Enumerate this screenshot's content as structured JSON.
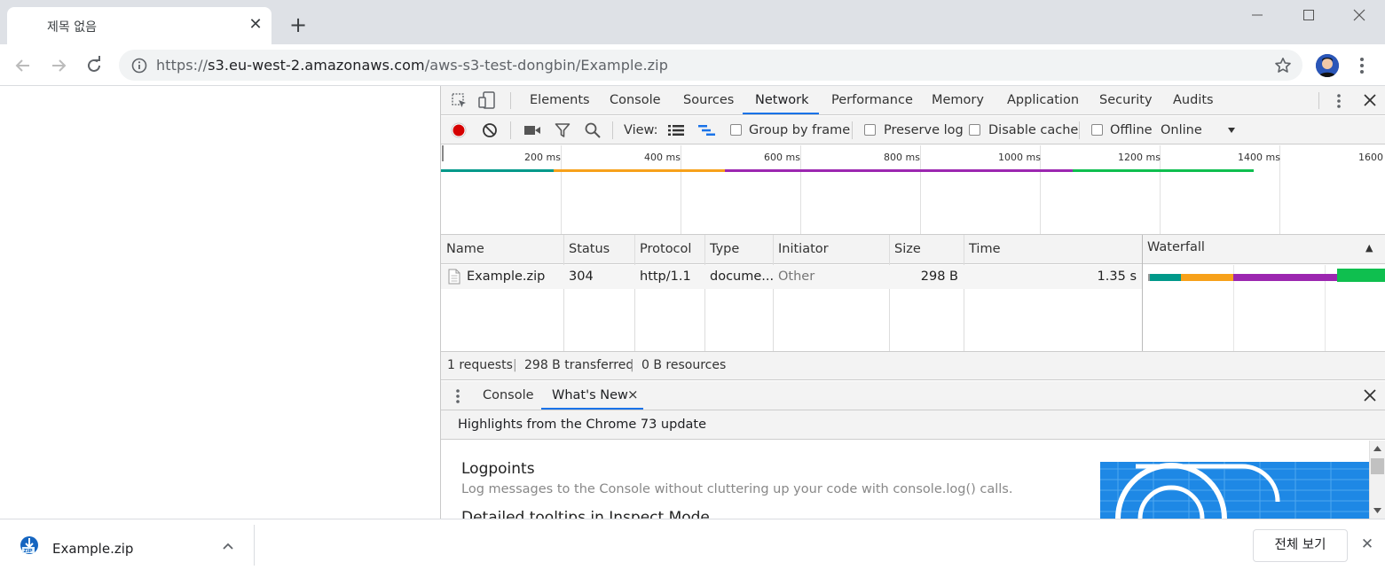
{
  "browser": {
    "tab_title": "제목 없음",
    "tab_close": "✕",
    "new_tab": "+",
    "url_scheme": "https://",
    "url_host": "s3.eu-west-2.amazonaws.com",
    "url_path": "/aws-s3-test-dongbin/Example.zip"
  },
  "devtools": {
    "tabs": [
      "Elements",
      "Console",
      "Sources",
      "Network",
      "Performance",
      "Memory",
      "Application",
      "Security",
      "Audits"
    ],
    "active_tab": "Network",
    "toolbar": {
      "view_label": "View:",
      "group_by_frame": "Group by frame",
      "preserve_log": "Preserve log",
      "disable_cache": "Disable cache",
      "offline": "Offline",
      "throttling": "Online"
    },
    "overview_ticks": [
      "200 ms",
      "400 ms",
      "600 ms",
      "800 ms",
      "1000 ms",
      "1200 ms",
      "1400 ms",
      "1600"
    ],
    "columns": [
      "Name",
      "Status",
      "Protocol",
      "Type",
      "Initiator",
      "Size",
      "Time",
      "Waterfall"
    ],
    "sort_indicator": "▲",
    "request": {
      "name": "Example.zip",
      "status": "304",
      "protocol": "http/1.1",
      "type": "docume...",
      "initiator": "Other",
      "size": "298 B",
      "time": "1.35 s"
    },
    "summary": {
      "requests": "1 requests",
      "transferred": "298 B transferred",
      "resources": "0 B resources",
      "sep": "|"
    },
    "drawer": {
      "tabs": [
        "Console",
        "What's New"
      ],
      "active_tab": "What's New",
      "tab_close": "×",
      "subtitle": "Highlights from the Chrome 73 update",
      "heading": "Logpoints",
      "description": "Log messages to the Console without cluttering up your code with console.log() calls.",
      "next_heading": "Detailed tooltips in Inspect Mode"
    }
  },
  "download_shelf": {
    "file_name": "Example.zip",
    "show_all": "전체 보기",
    "close": "✕"
  },
  "colors": {
    "accent": "#1a73e8",
    "record": "#d50000",
    "timing_stalled": "#00998a",
    "timing_connect": "#f7a11a",
    "timing_waiting": "#9c27b0",
    "timing_download": "#0fbf4f"
  }
}
